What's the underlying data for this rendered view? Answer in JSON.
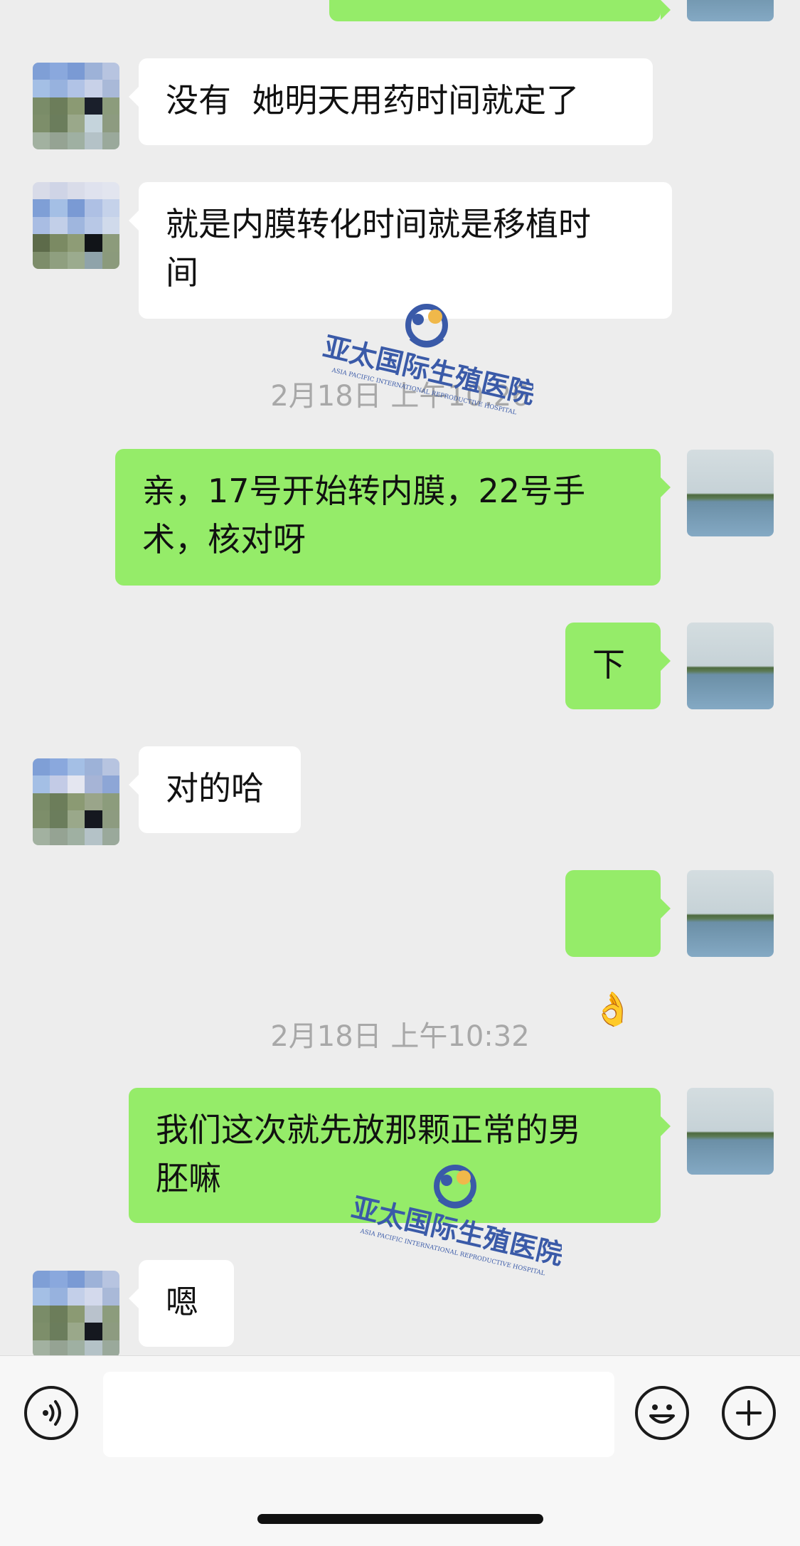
{
  "messages": [
    {
      "side": "out",
      "text": ""
    },
    {
      "side": "in",
      "text": "没有  她明天用药时间就定了"
    },
    {
      "side": "in",
      "text": "就是内膜转化时间就是移植时\n间"
    },
    {
      "side": "time",
      "text": "2月18日 上午10:26"
    },
    {
      "side": "out",
      "text": "亲，17号开始转内膜，22号手\n术，核对呀"
    },
    {
      "side": "out",
      "text": "下"
    },
    {
      "side": "in",
      "text": "对的哈"
    },
    {
      "side": "out",
      "text": "👌",
      "icon": "ok-hand-emoji"
    },
    {
      "side": "time",
      "text": "2月18日 上午10:32"
    },
    {
      "side": "out",
      "text": "我们这次就先放那颗正常的男\n胚嘛"
    },
    {
      "side": "in",
      "text": "嗯"
    }
  ],
  "watermark": {
    "name": "亚太国际生殖医院",
    "english": "ASIA PACIFIC INTERNATIONAL REPRODUCTIVE HOSPITAL",
    "color": "#3a5aa8"
  },
  "input_bar": {
    "voice_icon": "voice-icon",
    "input_value": "",
    "emoji_icon": "emoji-icon",
    "add_icon": "plus-icon"
  },
  "colors": {
    "background": "#ededed",
    "outgoing_bubble": "#95ec69",
    "incoming_bubble": "#ffffff",
    "timestamp": "#a8a8a8"
  }
}
